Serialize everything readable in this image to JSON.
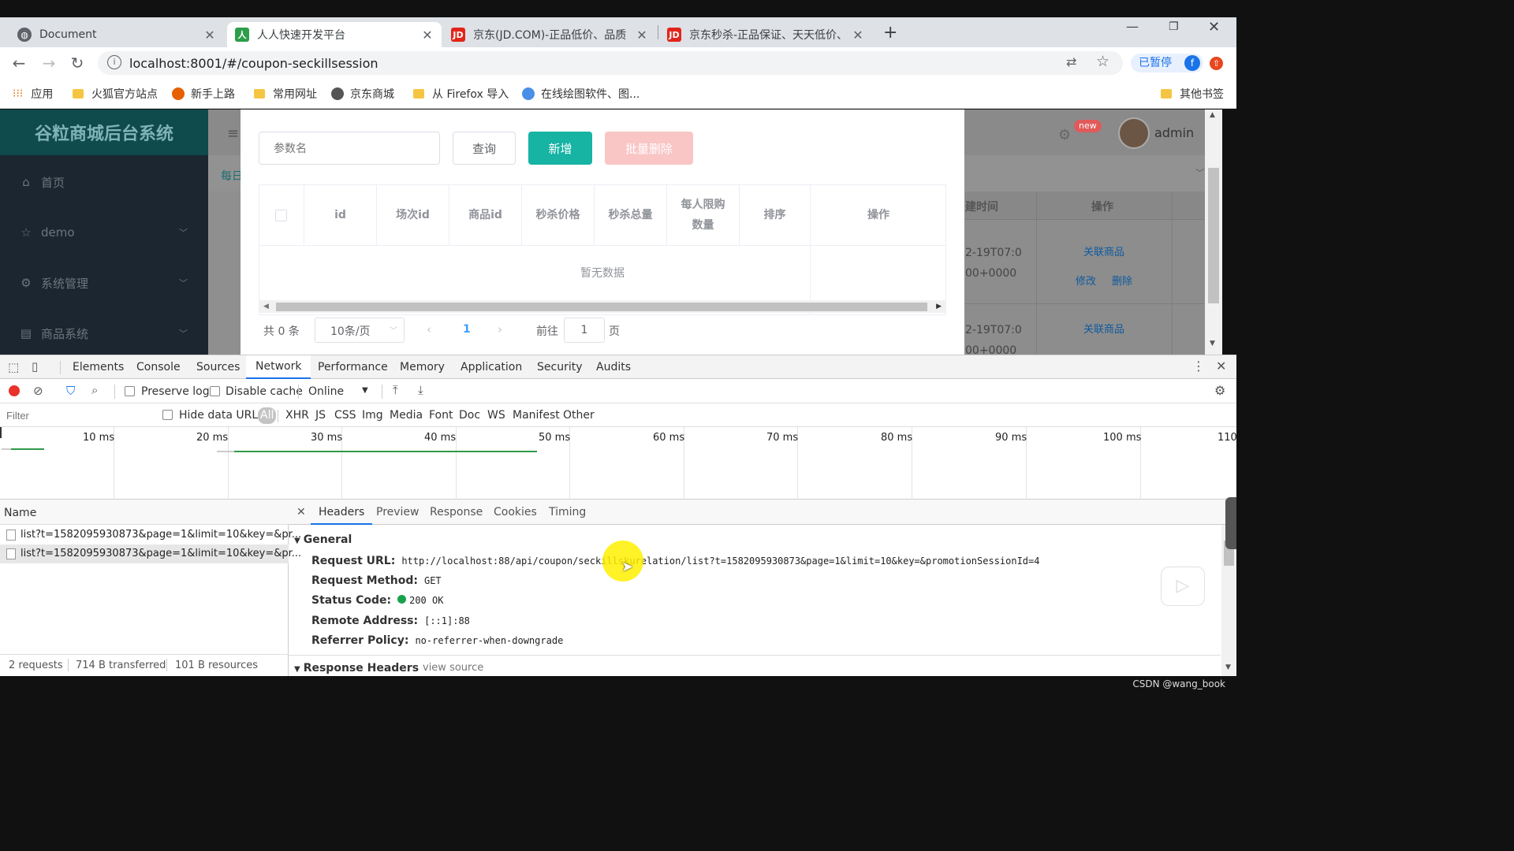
{
  "browser": {
    "tabs": [
      {
        "title": "Document",
        "icon": "globe-icon"
      },
      {
        "title": "人人快速开发平台",
        "icon": "renren-icon"
      },
      {
        "title": "京东(JD.COM)-正品低价、品质",
        "icon": "jd-icon"
      },
      {
        "title": "京东秒杀-正品保证、天天低价、",
        "icon": "jd-icon"
      }
    ],
    "url": "localhost:8001/#/coupon-seckillsession",
    "paused_label": "已暂停",
    "profile_initial": "f",
    "bookmarks": [
      "应用",
      "火狐官方站点",
      "新手上路",
      "常用网址",
      "京东商城",
      "从 Firefox 导入",
      "在线绘图软件、图..."
    ],
    "other_bookmarks": "其他书签"
  },
  "app": {
    "title": "谷粒商城后台系统",
    "menu": [
      {
        "label": "首页",
        "icon": "home-icon"
      },
      {
        "label": "demo",
        "icon": "star-icon"
      },
      {
        "label": "系统管理",
        "icon": "gear-icon"
      },
      {
        "label": "商品系统",
        "icon": "box-icon"
      }
    ],
    "user": "admin",
    "badge": "new",
    "tab_partial": "每日",
    "bg_table": {
      "headers": [
        "建时间",
        "操作"
      ],
      "rows": [
        {
          "time1": "2-19T07:0",
          "time2": "00+0000",
          "link": "关联商品",
          "edit": "修改",
          "del": "删除"
        },
        {
          "time1": "2-19T07:0",
          "time2": "00+0000",
          "link": "关联商品",
          "edit": "修改",
          "del": "删除"
        }
      ]
    }
  },
  "dialog": {
    "search_placeholder": "参数名",
    "query": "查询",
    "add": "新增",
    "batch_delete": "批量删除",
    "columns": [
      "id",
      "场次id",
      "商品id",
      "秒杀价格",
      "秒杀总量",
      "每人限购数量",
      "排序",
      "操作"
    ],
    "empty_text": "暂无数据",
    "pager": {
      "total": "共 0 条",
      "page_size": "10条/页",
      "current": "1",
      "goto": "前往",
      "goto_value": "1",
      "page_unit": "页"
    }
  },
  "devtools": {
    "tabs": [
      "Elements",
      "Console",
      "Sources",
      "Network",
      "Performance",
      "Memory",
      "Application",
      "Security",
      "Audits"
    ],
    "active_tab": "Network",
    "preserve_log": "Preserve log",
    "disable_cache": "Disable cache",
    "throttle": "Online",
    "filter_placeholder": "Filter",
    "hide_data_urls": "Hide data URLs",
    "types": [
      "All",
      "XHR",
      "JS",
      "CSS",
      "Img",
      "Media",
      "Font",
      "Doc",
      "WS",
      "Manifest",
      "Other"
    ],
    "ticks": [
      "10 ms",
      "20 ms",
      "30 ms",
      "40 ms",
      "50 ms",
      "60 ms",
      "70 ms",
      "80 ms",
      "90 ms",
      "100 ms",
      "110"
    ],
    "name_header": "Name",
    "requests": [
      "list?t=1582095930873&page=1&limit=10&key=&pr...",
      "list?t=1582095930873&page=1&limit=10&key=&pr..."
    ],
    "summary": [
      "2 requests",
      "714 B transferred",
      "101 B resources"
    ],
    "detail_tabs": [
      "Headers",
      "Preview",
      "Response",
      "Cookies",
      "Timing"
    ],
    "general_label": "General",
    "general": {
      "request_url_k": "Request URL:",
      "request_url": "http://localhost:88/api/coupon/seckillskurelation/list?t=1582095930873&page=1&limit=10&key=&promotionSessionId=4",
      "method_k": "Request Method:",
      "method": "GET",
      "status_k": "Status Code:",
      "status": "200 OK",
      "remote_k": "Remote Address:",
      "remote": "[::1]:88",
      "referrer_k": "Referrer Policy:",
      "referrer": "no-referrer-when-downgrade"
    },
    "response_headers_label": "Response Headers",
    "view_source": "view source"
  },
  "watermark": "CSDN @wang_book",
  "colors": {
    "primary": "#17b3a3",
    "danger_light": "#f9c5c5",
    "link": "#409eff",
    "sidebar": "#1b2630"
  }
}
